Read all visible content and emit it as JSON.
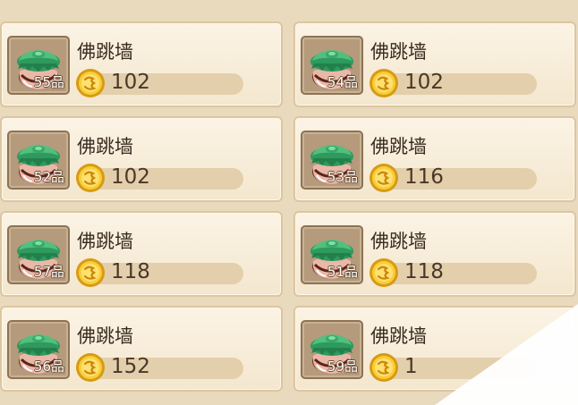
{
  "items": [
    {
      "name": "佛跳墙",
      "grade": "55品",
      "price": "102"
    },
    {
      "name": "佛跳墙",
      "grade": "54品",
      "price": "102"
    },
    {
      "name": "佛跳墙",
      "grade": "52品",
      "price": "102"
    },
    {
      "name": "佛跳墙",
      "grade": "53品",
      "price": "116"
    },
    {
      "name": "佛跳墙",
      "grade": "57品",
      "price": "118"
    },
    {
      "name": "佛跳墙",
      "grade": "51品",
      "price": "118"
    },
    {
      "name": "佛跳墙",
      "grade": "56品",
      "price": "152"
    },
    {
      "name": "佛跳墙",
      "grade": "59品",
      "price": "1"
    }
  ],
  "icons": {
    "item": "clay-jar-icon",
    "currency": "gold-coin-icon"
  },
  "colors": {
    "card_bg": "#fbf3e4",
    "thumb_bg": "#b59a7c",
    "jar_lid": "#2e9a5e",
    "coin": "#f2c230"
  }
}
